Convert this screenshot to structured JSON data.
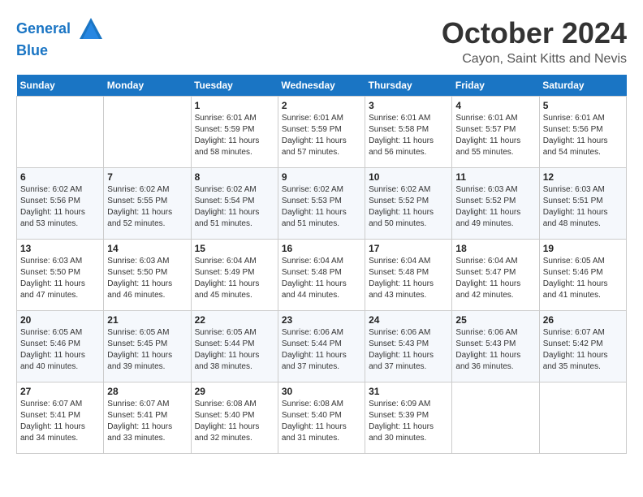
{
  "header": {
    "logo_line1": "General",
    "logo_line2": "Blue",
    "month_title": "October 2024",
    "location": "Cayon, Saint Kitts and Nevis"
  },
  "weekdays": [
    "Sunday",
    "Monday",
    "Tuesday",
    "Wednesday",
    "Thursday",
    "Friday",
    "Saturday"
  ],
  "weeks": [
    [
      {
        "day": "",
        "sunrise": "",
        "sunset": "",
        "daylight": ""
      },
      {
        "day": "",
        "sunrise": "",
        "sunset": "",
        "daylight": ""
      },
      {
        "day": "1",
        "sunrise": "Sunrise: 6:01 AM",
        "sunset": "Sunset: 5:59 PM",
        "daylight": "Daylight: 11 hours and 58 minutes."
      },
      {
        "day": "2",
        "sunrise": "Sunrise: 6:01 AM",
        "sunset": "Sunset: 5:59 PM",
        "daylight": "Daylight: 11 hours and 57 minutes."
      },
      {
        "day": "3",
        "sunrise": "Sunrise: 6:01 AM",
        "sunset": "Sunset: 5:58 PM",
        "daylight": "Daylight: 11 hours and 56 minutes."
      },
      {
        "day": "4",
        "sunrise": "Sunrise: 6:01 AM",
        "sunset": "Sunset: 5:57 PM",
        "daylight": "Daylight: 11 hours and 55 minutes."
      },
      {
        "day": "5",
        "sunrise": "Sunrise: 6:01 AM",
        "sunset": "Sunset: 5:56 PM",
        "daylight": "Daylight: 11 hours and 54 minutes."
      }
    ],
    [
      {
        "day": "6",
        "sunrise": "Sunrise: 6:02 AM",
        "sunset": "Sunset: 5:56 PM",
        "daylight": "Daylight: 11 hours and 53 minutes."
      },
      {
        "day": "7",
        "sunrise": "Sunrise: 6:02 AM",
        "sunset": "Sunset: 5:55 PM",
        "daylight": "Daylight: 11 hours and 52 minutes."
      },
      {
        "day": "8",
        "sunrise": "Sunrise: 6:02 AM",
        "sunset": "Sunset: 5:54 PM",
        "daylight": "Daylight: 11 hours and 51 minutes."
      },
      {
        "day": "9",
        "sunrise": "Sunrise: 6:02 AM",
        "sunset": "Sunset: 5:53 PM",
        "daylight": "Daylight: 11 hours and 51 minutes."
      },
      {
        "day": "10",
        "sunrise": "Sunrise: 6:02 AM",
        "sunset": "Sunset: 5:52 PM",
        "daylight": "Daylight: 11 hours and 50 minutes."
      },
      {
        "day": "11",
        "sunrise": "Sunrise: 6:03 AM",
        "sunset": "Sunset: 5:52 PM",
        "daylight": "Daylight: 11 hours and 49 minutes."
      },
      {
        "day": "12",
        "sunrise": "Sunrise: 6:03 AM",
        "sunset": "Sunset: 5:51 PM",
        "daylight": "Daylight: 11 hours and 48 minutes."
      }
    ],
    [
      {
        "day": "13",
        "sunrise": "Sunrise: 6:03 AM",
        "sunset": "Sunset: 5:50 PM",
        "daylight": "Daylight: 11 hours and 47 minutes."
      },
      {
        "day": "14",
        "sunrise": "Sunrise: 6:03 AM",
        "sunset": "Sunset: 5:50 PM",
        "daylight": "Daylight: 11 hours and 46 minutes."
      },
      {
        "day": "15",
        "sunrise": "Sunrise: 6:04 AM",
        "sunset": "Sunset: 5:49 PM",
        "daylight": "Daylight: 11 hours and 45 minutes."
      },
      {
        "day": "16",
        "sunrise": "Sunrise: 6:04 AM",
        "sunset": "Sunset: 5:48 PM",
        "daylight": "Daylight: 11 hours and 44 minutes."
      },
      {
        "day": "17",
        "sunrise": "Sunrise: 6:04 AM",
        "sunset": "Sunset: 5:48 PM",
        "daylight": "Daylight: 11 hours and 43 minutes."
      },
      {
        "day": "18",
        "sunrise": "Sunrise: 6:04 AM",
        "sunset": "Sunset: 5:47 PM",
        "daylight": "Daylight: 11 hours and 42 minutes."
      },
      {
        "day": "19",
        "sunrise": "Sunrise: 6:05 AM",
        "sunset": "Sunset: 5:46 PM",
        "daylight": "Daylight: 11 hours and 41 minutes."
      }
    ],
    [
      {
        "day": "20",
        "sunrise": "Sunrise: 6:05 AM",
        "sunset": "Sunset: 5:46 PM",
        "daylight": "Daylight: 11 hours and 40 minutes."
      },
      {
        "day": "21",
        "sunrise": "Sunrise: 6:05 AM",
        "sunset": "Sunset: 5:45 PM",
        "daylight": "Daylight: 11 hours and 39 minutes."
      },
      {
        "day": "22",
        "sunrise": "Sunrise: 6:05 AM",
        "sunset": "Sunset: 5:44 PM",
        "daylight": "Daylight: 11 hours and 38 minutes."
      },
      {
        "day": "23",
        "sunrise": "Sunrise: 6:06 AM",
        "sunset": "Sunset: 5:44 PM",
        "daylight": "Daylight: 11 hours and 37 minutes."
      },
      {
        "day": "24",
        "sunrise": "Sunrise: 6:06 AM",
        "sunset": "Sunset: 5:43 PM",
        "daylight": "Daylight: 11 hours and 37 minutes."
      },
      {
        "day": "25",
        "sunrise": "Sunrise: 6:06 AM",
        "sunset": "Sunset: 5:43 PM",
        "daylight": "Daylight: 11 hours and 36 minutes."
      },
      {
        "day": "26",
        "sunrise": "Sunrise: 6:07 AM",
        "sunset": "Sunset: 5:42 PM",
        "daylight": "Daylight: 11 hours and 35 minutes."
      }
    ],
    [
      {
        "day": "27",
        "sunrise": "Sunrise: 6:07 AM",
        "sunset": "Sunset: 5:41 PM",
        "daylight": "Daylight: 11 hours and 34 minutes."
      },
      {
        "day": "28",
        "sunrise": "Sunrise: 6:07 AM",
        "sunset": "Sunset: 5:41 PM",
        "daylight": "Daylight: 11 hours and 33 minutes."
      },
      {
        "day": "29",
        "sunrise": "Sunrise: 6:08 AM",
        "sunset": "Sunset: 5:40 PM",
        "daylight": "Daylight: 11 hours and 32 minutes."
      },
      {
        "day": "30",
        "sunrise": "Sunrise: 6:08 AM",
        "sunset": "Sunset: 5:40 PM",
        "daylight": "Daylight: 11 hours and 31 minutes."
      },
      {
        "day": "31",
        "sunrise": "Sunrise: 6:09 AM",
        "sunset": "Sunset: 5:39 PM",
        "daylight": "Daylight: 11 hours and 30 minutes."
      },
      {
        "day": "",
        "sunrise": "",
        "sunset": "",
        "daylight": ""
      },
      {
        "day": "",
        "sunrise": "",
        "sunset": "",
        "daylight": ""
      }
    ]
  ]
}
